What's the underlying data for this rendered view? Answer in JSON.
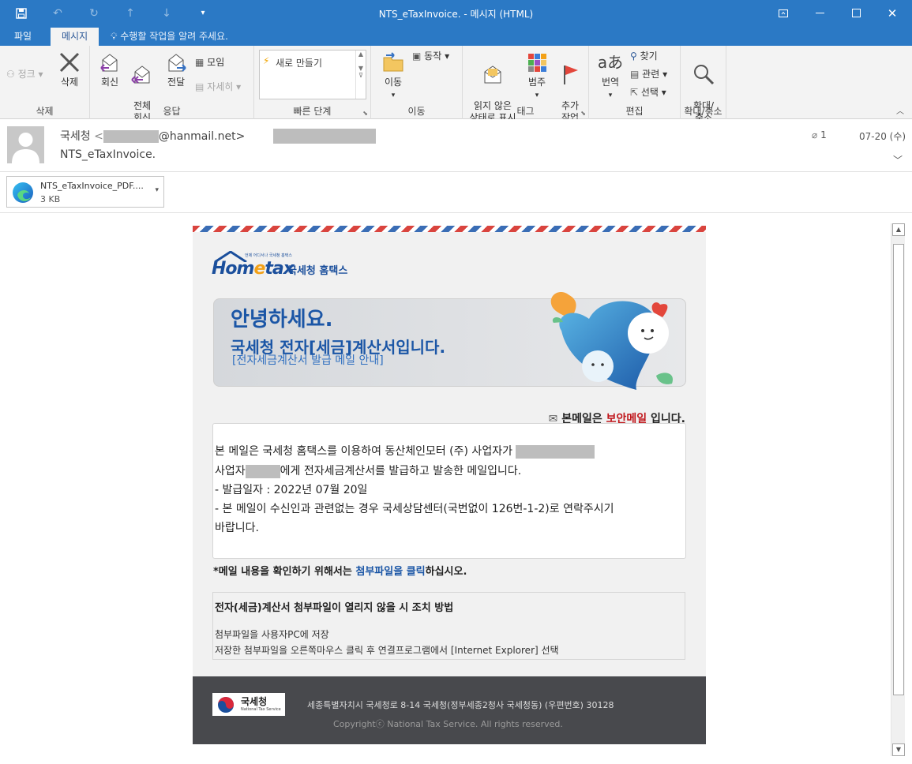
{
  "window": {
    "title": "NTS_eTaxInvoice. - 메시지 (HTML)",
    "quick_access": [
      "save-icon",
      "undo-icon",
      "redo-icon",
      "up-icon",
      "down-icon",
      "customize-icon"
    ]
  },
  "tabs": [
    {
      "label": "파일",
      "active": false
    },
    {
      "label": "메시지",
      "active": true
    }
  ],
  "tell_me": "수행할 작업을 알려 주세요.",
  "ribbon": {
    "groups": {
      "delete": "삭제",
      "respond": "응답",
      "quick_steps": "빠른 단계",
      "move": "이동",
      "tags": "태그",
      "editing": "편집",
      "zoom": "확대/축소"
    },
    "buttons": {
      "junk": "정크",
      "delete": "삭제",
      "reply": "회신",
      "reply_all": "전체\n회신",
      "forward": "전달",
      "meeting": "모임",
      "more": "자세히",
      "new_quick_step": "새로 만들기",
      "move": "이동",
      "actions": "동작",
      "mark_unread": "읽지 않은\n상태로 표시",
      "categorize": "범주",
      "follow_up": "추가\n작업",
      "translate": "번역",
      "find": "찾기",
      "related": "관련",
      "select": "선택",
      "zoom": "확대/\n축소"
    }
  },
  "message": {
    "sender_name": "국세청",
    "sender_email_suffix": "@hanmail.net>",
    "subject": "NTS_eTaxInvoice.",
    "attachment_count": "1",
    "date": "07-20 (수)",
    "attachment": {
      "name": "NTS_eTaxInvoice_PDF....",
      "size": "3 KB"
    }
  },
  "email": {
    "logo": {
      "home": "Hom",
      "e": "e",
      "tax": "tax",
      "name": "국세청 홈택스",
      "tagline": "언제 어디서나 국세청 홈택스"
    },
    "banner": {
      "greeting": "안녕하세요.",
      "headline": "국세청 전자[세금]계산서입니다.",
      "sub": "[전자세금계산서 발급 메일 안내]"
    },
    "secure": {
      "prefix": "본메일은",
      "highlight": "보안메일",
      "suffix": "입니다."
    },
    "notice": {
      "line1": "본 메일은 국세청 홈택스를 이용하여 동산체인모터 (주)  사업자가 ",
      "line2a": "사업자",
      "line2b": "에게 전자세금계산서를 발급하고 발송한 메일입니다.",
      "line3": "- 발급일자 : 2022년 07월 20일",
      "line4": "- 본 메일이 수신인과 관련없는 경우 국세상담센터(국번없이 126번-1-2)로 연락주시기",
      "line5": "바랍니다."
    },
    "confirm": {
      "prefix": "*메일 내용을 확인하기 위해서는 ",
      "link": "첨부파일을 클릭",
      "suffix": "하십시오."
    },
    "help": {
      "title": "전자(세금)계산서 첨부파일이 열리지 않을 시 조치 방법",
      "step1": "첨부파일을 사용자PC에 저장",
      "step2": "저장한 첨부파일을 오른쪽마우스 클릭 후 연결프로그램에서 [Internet Explorer] 선택"
    },
    "footer": {
      "logo_name": "국세청",
      "logo_en": "National Tax Service",
      "address": "세종특별자치시 국세청로 8-14 국세청(정부세종2청사 국세청동) (우편번호) 30128",
      "copyright": "Copyrightⓒ National Tax Service.  All rights reserved."
    }
  },
  "colors": {
    "accent": "#2b79c5",
    "nts_blue": "#1b56a6",
    "secure_red": "#c0161b",
    "footer": "#48494d"
  }
}
